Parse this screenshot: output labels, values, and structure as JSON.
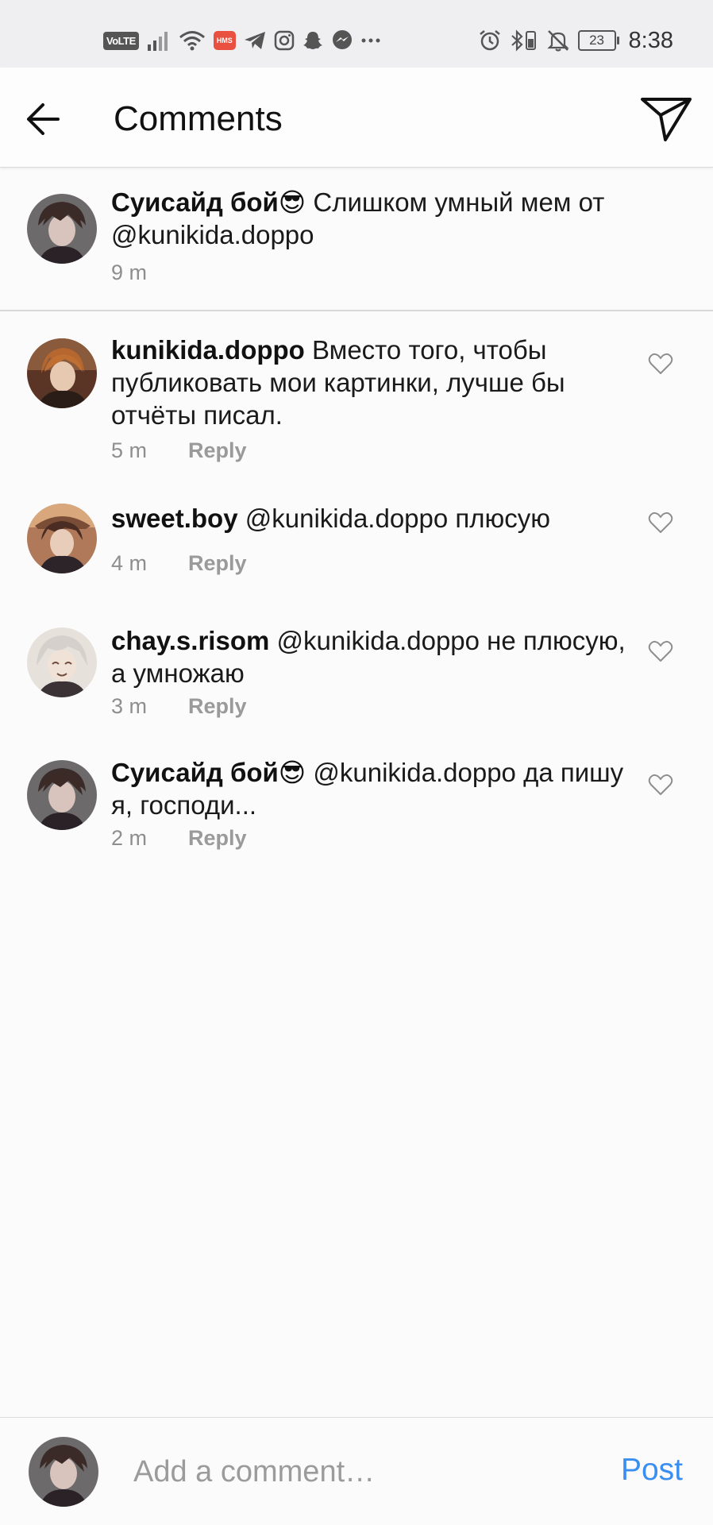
{
  "status_bar": {
    "volte_label": "VoLTE",
    "hms_label": "HMS",
    "battery_level": "23",
    "time": "8:38"
  },
  "header": {
    "title": "Comments"
  },
  "caption": {
    "username": "Суисайд бой😎",
    "text": "Слишком умный мем от @kunikida.doppo",
    "time": "9 m"
  },
  "comments": [
    {
      "username": "kunikida.doppo",
      "text": "Вместо того, чтобы публиковать мои картинки, лучше бы отчёты писал.",
      "time": "5 m",
      "reply_label": "Reply"
    },
    {
      "username": "sweet.boy",
      "text": "@kunikida.doppo плюсую",
      "time": "4 m",
      "reply_label": "Reply"
    },
    {
      "username": "chay.s.risom",
      "text": "@kunikida.doppo не плюсую, а умножаю",
      "time": "3 m",
      "reply_label": "Reply"
    },
    {
      "username": "Суисайд бой😎",
      "text": "@kunikida.doppo да пишу я, господи...",
      "time": "2 m",
      "reply_label": "Reply"
    }
  ],
  "composer": {
    "placeholder": "Add a comment…",
    "post_label": "Post"
  },
  "colors": {
    "accent": "#3a8ef0",
    "muted_text": "#8e8e8e",
    "background": "#fcfbfc",
    "status_bar": "#efeef1"
  }
}
